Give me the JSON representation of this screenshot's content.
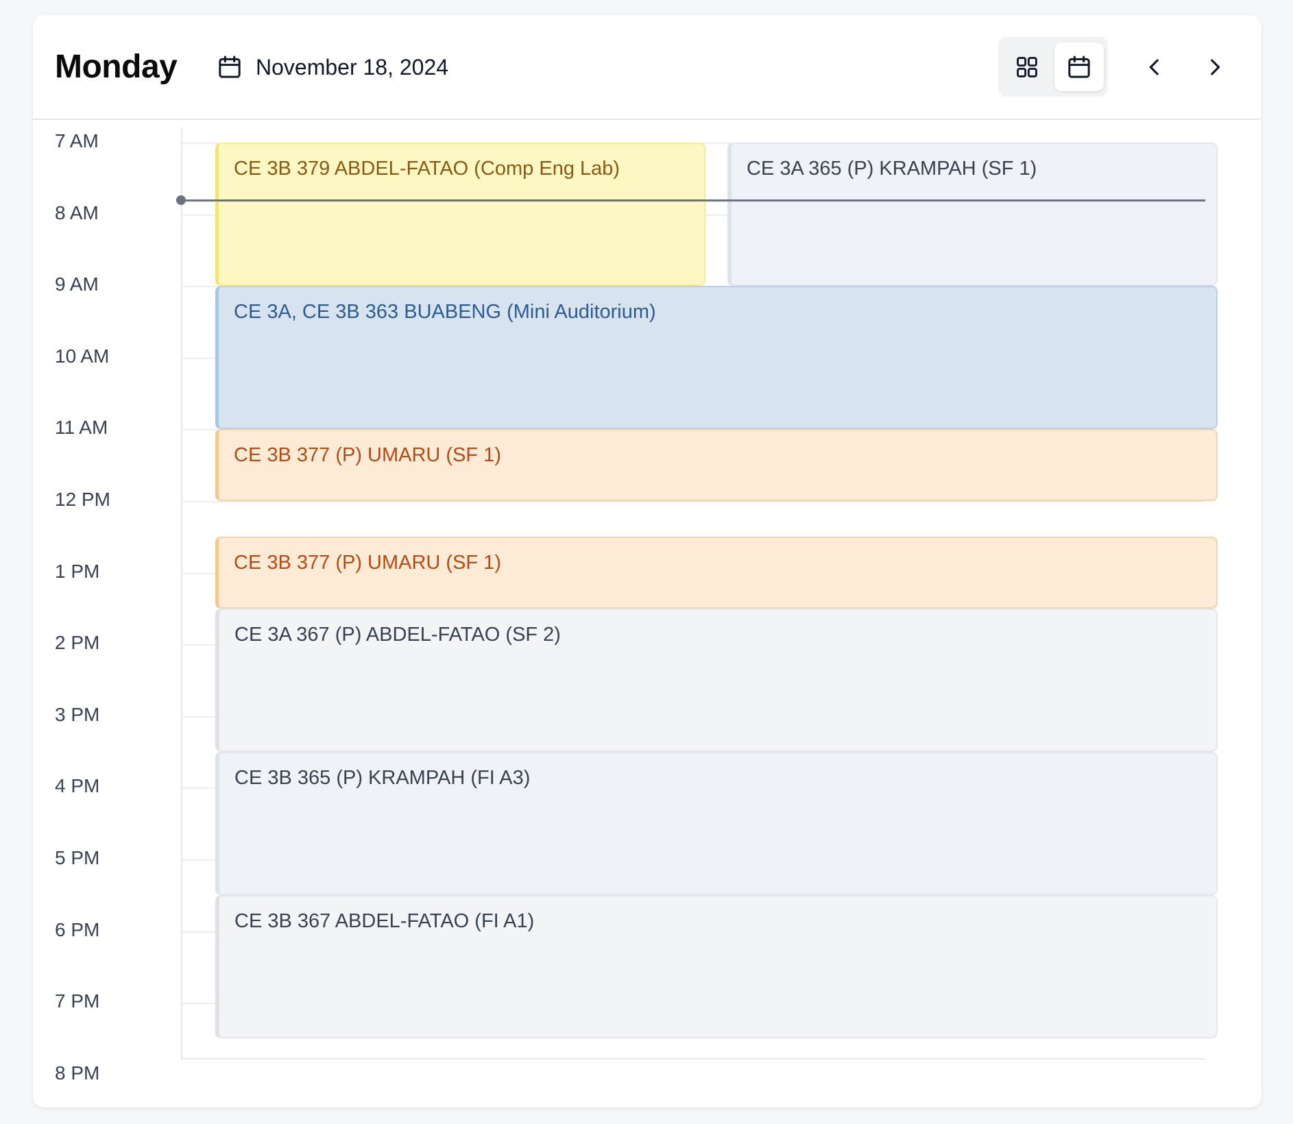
{
  "header": {
    "day": "Monday",
    "date": "November 18, 2024",
    "icons": {
      "date": "calendar-icon",
      "grid_view": "grid-view-icon",
      "calendar_view": "calendar-view-icon",
      "prev": "chevron-left-icon",
      "next": "chevron-right-icon"
    },
    "active_view": "calendar"
  },
  "time_labels": [
    "7 AM",
    "8 AM",
    "9 AM",
    "10 AM",
    "11 AM",
    "12 PM",
    "1 PM",
    "2 PM",
    "3 PM",
    "4 PM",
    "5 PM",
    "6 PM",
    "7 PM",
    "8 PM"
  ],
  "events": [
    {
      "title": "CE 3B 379 ABDEL-FATAO (Comp Eng Lab)",
      "color": "yellow"
    },
    {
      "title": "CE 3A 365 (P) KRAMPAH (SF 1)",
      "color": "slate"
    },
    {
      "title": "CE 3A, CE 3B 363 BUABENG (Mini Auditorium)",
      "color": "blue"
    },
    {
      "title": "CE 3B 377 (P) UMARU (SF 1)",
      "color": "orange"
    },
    {
      "title": "CE 3B 377 (P) UMARU (SF 1)",
      "color": "orange"
    },
    {
      "title": "CE 3A 367 (P) ABDEL-FATAO (SF 2)",
      "color": "gray"
    },
    {
      "title": "CE 3B 365 (P) KRAMPAH (FI A3)",
      "color": "slate"
    },
    {
      "title": "CE 3B 367 ABDEL-FATAO (FI A1)",
      "color": "gray"
    }
  ],
  "colors": {
    "yellow": "#fdf7c4",
    "slate": "#eff3f8",
    "blue": "#d8e3f0",
    "orange": "#fdebd6",
    "gray": "#f3f4f5",
    "now_indicator": "#6b7280"
  }
}
